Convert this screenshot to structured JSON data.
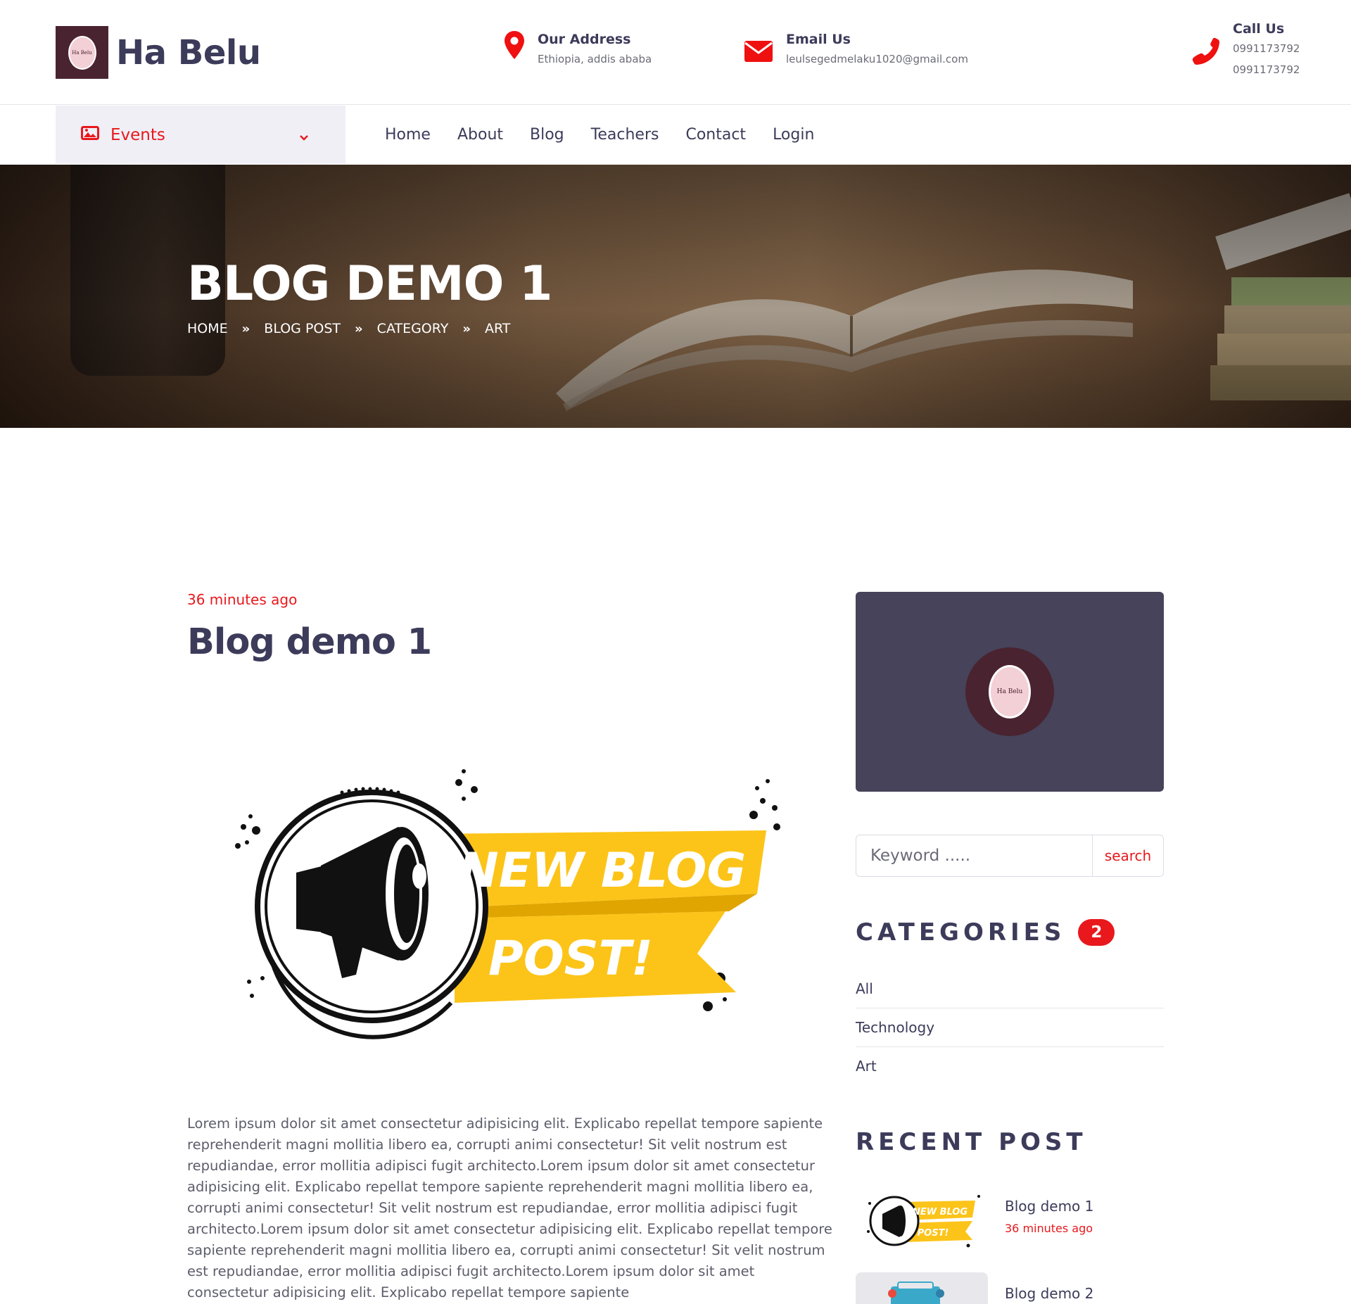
{
  "brand": {
    "name": "Ha Belu",
    "logo_text": "Ha Belu"
  },
  "contacts": {
    "address": {
      "title": "Our Address",
      "value": "Ethiopia, addis ababa"
    },
    "email": {
      "title": "Email Us",
      "value": "leulsegedmelaku1020@gmail.com"
    },
    "call": {
      "title": "Call Us",
      "phone1": "0991173792",
      "phone2": "0991173792"
    }
  },
  "nav": {
    "events_label": "Events",
    "items": [
      "Home",
      "About",
      "Blog",
      "Teachers",
      "Contact",
      "Login"
    ]
  },
  "hero": {
    "title": "BLOG DEMO 1",
    "breadcrumbs": [
      "HOME",
      "BLOG POST",
      "CATEGORY",
      "ART"
    ]
  },
  "post": {
    "time": "36 minutes ago",
    "title": "Blog demo 1",
    "image_text_line1": "NEW BLOG",
    "image_text_line2": "POST!",
    "body": "Lorem ipsum dolor sit amet consectetur adipisicing elit. Explicabo repellat tempore sapiente reprehenderit magni mollitia libero ea, corrupti animi consectetur! Sit velit nostrum est repudiandae, error mollitia adipisci fugit architecto.Lorem ipsum dolor sit amet consectetur adipisicing elit. Explicabo repellat tempore sapiente reprehenderit magni mollitia libero ea, corrupti animi consectetur! Sit velit nostrum est repudiandae, error mollitia adipisci fugit architecto.Lorem ipsum dolor sit amet consectetur adipisicing elit. Explicabo repellat tempore sapiente reprehenderit magni mollitia libero ea, corrupti animi consectetur! Sit velit nostrum est repudiandae, error mollitia adipisci fugit architecto.Lorem ipsum dolor sit amet consectetur adipisicing elit. Explicabo repellat tempore sapiente"
  },
  "sidebar": {
    "search": {
      "placeholder": "Keyword .....",
      "button": "search"
    },
    "categories": {
      "heading": "CATEGORIES",
      "count": "2",
      "items": [
        "All",
        "Technology",
        "Art"
      ]
    },
    "recent": {
      "heading": "RECENT POST",
      "posts": [
        {
          "title": "Blog demo 1",
          "time": "36 minutes ago",
          "thumb_line1": "NEW BLOG",
          "thumb_line2": "POST!"
        },
        {
          "title": "Blog demo 2"
        }
      ]
    }
  },
  "colors": {
    "accent": "#e8181c",
    "text": "#3c3b5a",
    "card": "#46435a",
    "logo_bg": "#4a2330",
    "banner": "#fcc419"
  }
}
